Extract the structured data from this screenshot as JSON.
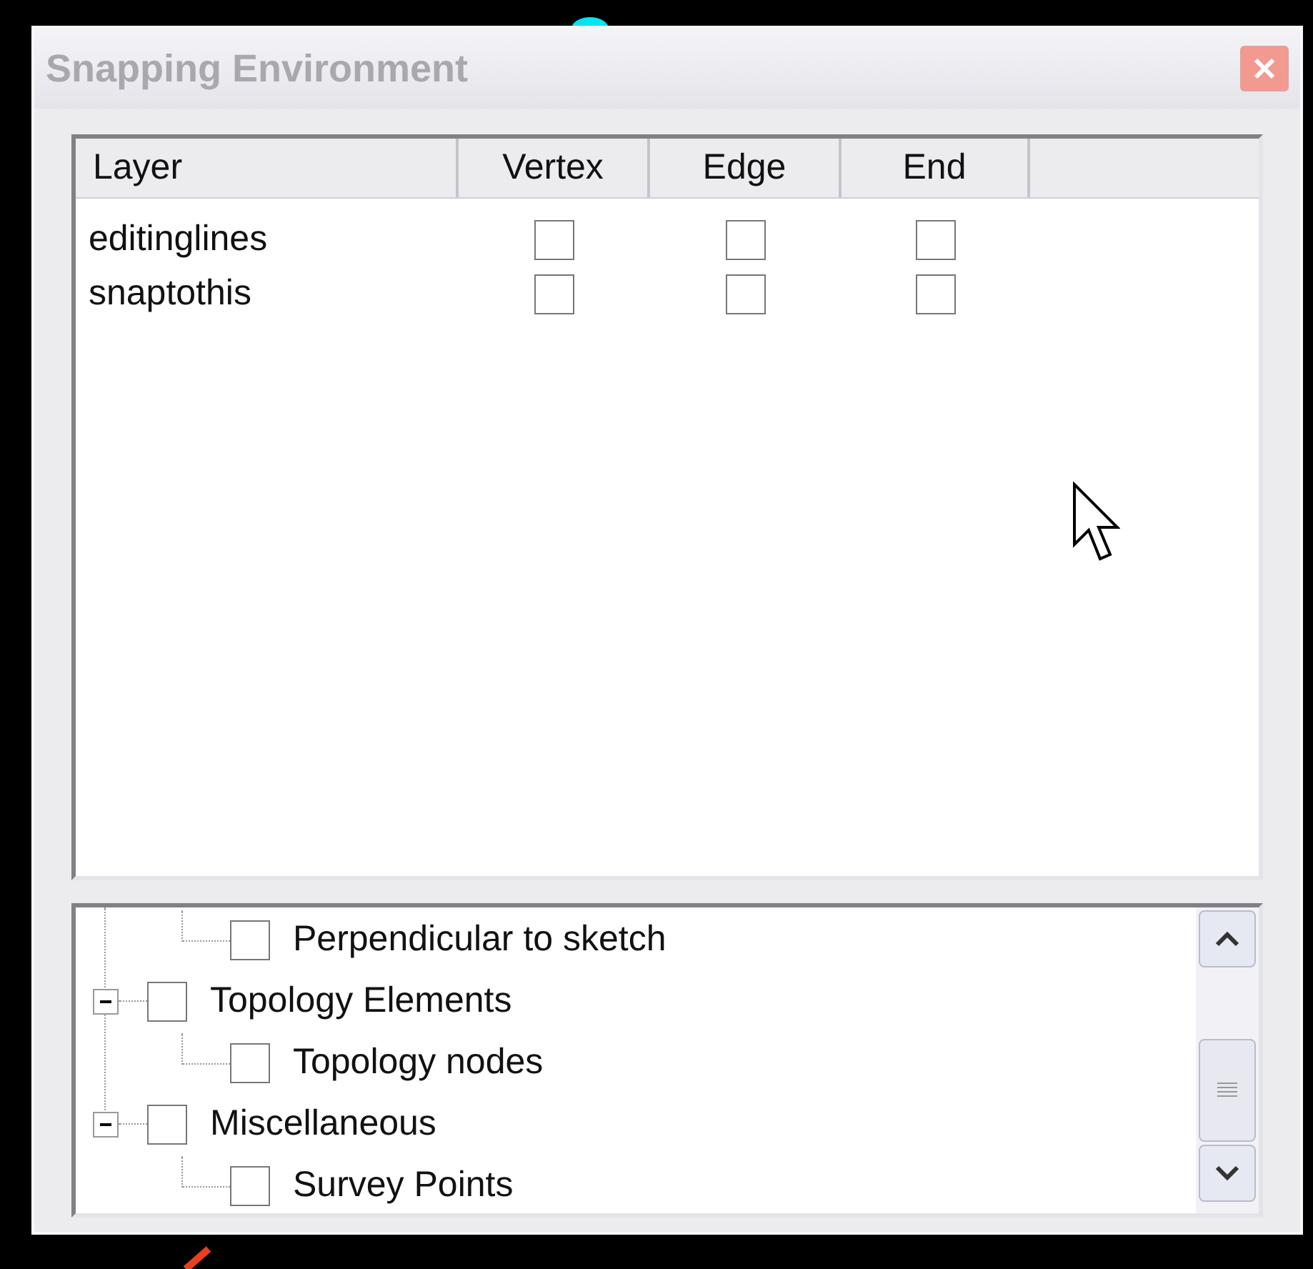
{
  "window": {
    "title": "Snapping Environment"
  },
  "table": {
    "columns": [
      "Layer",
      "Vertex",
      "Edge",
      "End"
    ],
    "rows": [
      {
        "layer": "editinglines",
        "vertex": false,
        "edge": false,
        "end": false
      },
      {
        "layer": "snaptothis",
        "vertex": false,
        "edge": false,
        "end": false
      }
    ]
  },
  "tree": [
    {
      "children": [
        {
          "label": "Perpendicular to sketch",
          "checked": false
        }
      ]
    },
    {
      "label": "Topology Elements",
      "checked": false,
      "expanded": true,
      "children": [
        {
          "label": "Topology nodes",
          "checked": false
        }
      ]
    },
    {
      "label": "Miscellaneous",
      "checked": false,
      "expanded": true,
      "children": [
        {
          "label": "Survey Points",
          "checked": false
        }
      ]
    }
  ]
}
